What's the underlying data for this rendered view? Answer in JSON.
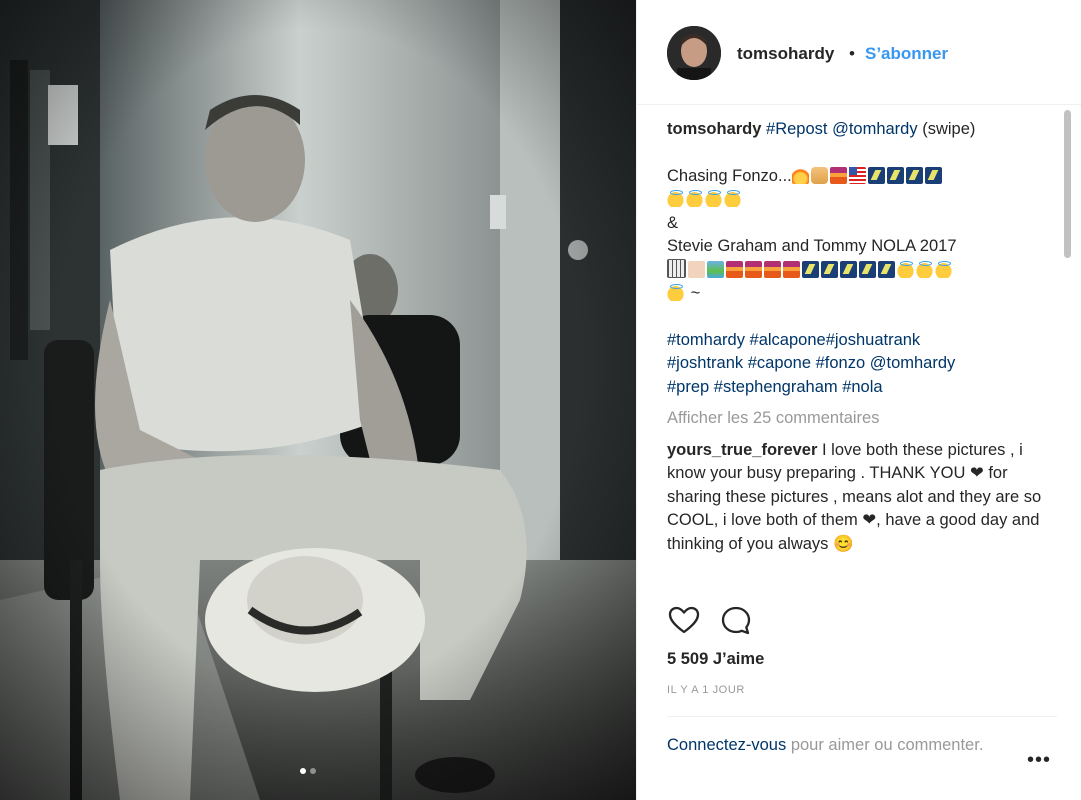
{
  "post": {
    "author": "tomsohardy",
    "bullet": "•",
    "follow_label": "S’abonner",
    "caption": {
      "username": "tomsohardy",
      "line1_tags": "#Repost @tomhardy",
      "line1_rest": " (swipe)",
      "line2_text": "Chasing Fonzo...",
      "line3": "&",
      "line4": "Stevie Graham and Tommy NOLA 2017",
      "line5_tail": " ~",
      "hashtags1": "#tomhardy #alcapone#joshuatrank",
      "hashtags2": "#joshtrank #capone #fonzo @tomhardy",
      "hashtags3": "#prep #stephengraham #nola"
    },
    "view_comments": "Afficher les 25 commentaires",
    "comment": {
      "username": "yours_true_forever",
      "text": " I love both these pictures , i know your busy preparing . THANK YOU ❤ for sharing these pictures , means alot and they are so COOL, i love both of them ❤, have a good day and thinking of you always 😊"
    },
    "likes": "5 509 J’aime",
    "time": "IL Y A 1 JOUR",
    "login": {
      "link": "Connectez-vous",
      "rest": " pour aimer ou commenter."
    },
    "more_menu": "•••"
  },
  "icons": {
    "like": "heart-icon",
    "comment": "comment-bubble-icon",
    "menu": "more-options-icon"
  },
  "colors": {
    "link_blue": "#3897f0",
    "hashtag_blue": "#003569",
    "muted": "#999999",
    "text": "#262626"
  }
}
